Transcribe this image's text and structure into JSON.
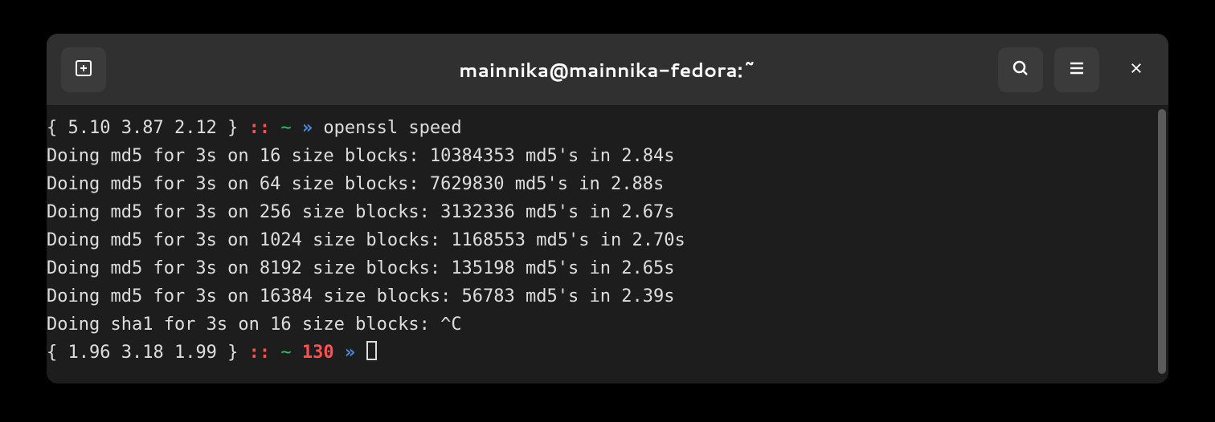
{
  "titlebar": {
    "title": "mainnika@mainnika-fedora:~"
  },
  "prompt1": {
    "open": "{ ",
    "load": "5.10 3.87 2.12",
    "close": " }",
    "sep": " :: ",
    "tilde": "~",
    "arrow": " » ",
    "command": "openssl speed"
  },
  "output": [
    "Doing md5 for 3s on 16 size blocks: 10384353 md5's in 2.84s",
    "Doing md5 for 3s on 64 size blocks: 7629830 md5's in 2.88s",
    "Doing md5 for 3s on 256 size blocks: 3132336 md5's in 2.67s",
    "Doing md5 for 3s on 1024 size blocks: 1168553 md5's in 2.70s",
    "Doing md5 for 3s on 8192 size blocks: 135198 md5's in 2.65s",
    "Doing md5 for 3s on 16384 size blocks: 56783 md5's in 2.39s",
    "Doing sha1 for 3s on 16 size blocks: ^C"
  ],
  "prompt2": {
    "open": "{ ",
    "load": "1.96 3.18 1.99",
    "close": " }",
    "sep": " :: ",
    "tilde": "~",
    "exitcode": " 130",
    "arrow": " » "
  }
}
